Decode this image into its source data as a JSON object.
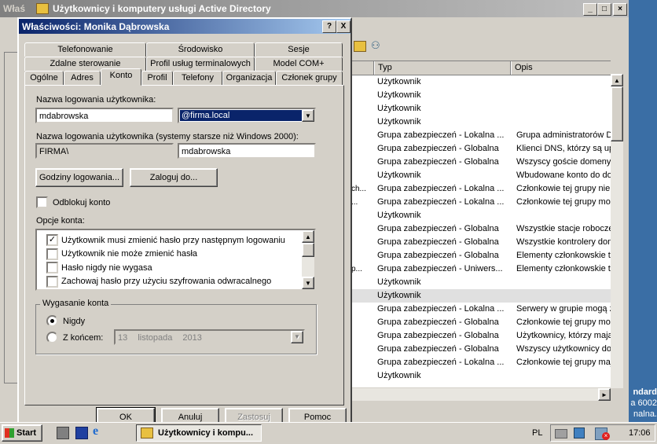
{
  "main_window": {
    "title_short": "Właś",
    "title": "Użytkownicy i komputery usługi Active Directory",
    "list": {
      "columns": [
        "Typ",
        "Opis"
      ],
      "rows": [
        {
          "typ": "Użytkownik",
          "opis": "",
          "prefix": ""
        },
        {
          "typ": "Użytkownik",
          "opis": "",
          "prefix": ""
        },
        {
          "typ": "Użytkownik",
          "opis": "",
          "prefix": ""
        },
        {
          "typ": "Użytkownik",
          "opis": "",
          "prefix": ""
        },
        {
          "typ": "Grupa zabezpieczeń - Lokalna ...",
          "opis": "Grupa administratorów DN",
          "prefix": ""
        },
        {
          "typ": "Grupa zabezpieczeń - Globalna",
          "opis": "Klienci DNS, którzy są upo",
          "prefix": ""
        },
        {
          "typ": "Grupa zabezpieczeń - Globalna",
          "opis": "Wszyscy goście domeny",
          "prefix": ""
        },
        {
          "typ": "Użytkownik",
          "opis": "Wbudowane konto do dos",
          "prefix": ""
        },
        {
          "typ": "Grupa zabezpieczeń - Lokalna ...",
          "opis": "Członkowie tej grupy nie .",
          "prefix": "ch..."
        },
        {
          "typ": "Grupa zabezpieczeń - Lokalna ...",
          "opis": "Członkowie tej grupy mog",
          "prefix": "..."
        },
        {
          "typ": "Użytkownik",
          "opis": "",
          "prefix": ""
        },
        {
          "typ": "Grupa zabezpieczeń - Globalna",
          "opis": "Wszystkie stacje robocze i",
          "prefix": ""
        },
        {
          "typ": "Grupa zabezpieczeń - Globalna",
          "opis": "Wszystkie kontrolery dom.",
          "prefix": ""
        },
        {
          "typ": "Grupa zabezpieczeń - Globalna",
          "opis": "Elementy członkowskie tej",
          "prefix": ""
        },
        {
          "typ": "Grupa zabezpieczeń - Uniwers...",
          "opis": "Elementy członkowskie tej",
          "prefix": "p..."
        },
        {
          "typ": "Użytkownik",
          "opis": "",
          "prefix": ""
        },
        {
          "typ": "Użytkownik",
          "opis": "",
          "prefix": ""
        },
        {
          "typ": "Grupa zabezpieczeń - Lokalna ...",
          "opis": "Serwery w grupie mogą z.",
          "prefix": ""
        },
        {
          "typ": "Grupa zabezpieczeń - Globalna",
          "opis": "Członkowie tej grupy mog",
          "prefix": ""
        },
        {
          "typ": "Grupa zabezpieczeń - Globalna",
          "opis": "Użytkownicy, którzy mają",
          "prefix": ""
        },
        {
          "typ": "Grupa zabezpieczeń - Globalna",
          "opis": "Wszyscy użytkownicy do...",
          "prefix": ""
        },
        {
          "typ": "Grupa zabezpieczeń - Lokalna ...",
          "opis": "Członkowie tej grupy maj.",
          "prefix": ""
        },
        {
          "typ": "Użytkownik",
          "opis": "",
          "prefix": ""
        }
      ],
      "selected_index": 16
    }
  },
  "dialog": {
    "title": "Właściwości: Monika Dąbrowska",
    "help_btn": "?",
    "close_btn": "X",
    "tabs_row1": [
      "Telefonowanie",
      "Środowisko",
      "Sesje"
    ],
    "tabs_row2": [
      "Zdalne sterowanie",
      "Profil usług terminalowych",
      "Model COM+"
    ],
    "tabs_row3": [
      "Ogólne",
      "Adres",
      "Konto",
      "Profil",
      "Telefony",
      "Organizacja",
      "Członek grupy"
    ],
    "active_tab": "Konto",
    "logon_label": "Nazwa logowania użytkownika:",
    "logon_value": "mdabrowska",
    "domain_value": "@firma.local",
    "legacy_label": "Nazwa logowania użytkownika (systemy starsze niż Windows 2000):",
    "legacy_domain": "FIRMA\\",
    "legacy_value": "mdabrowska",
    "logon_hours_btn": "Godziny logowania...",
    "logon_to_btn": "Zaloguj do...",
    "unlock_label": "Odblokuj konto",
    "options_label": "Opcje konta:",
    "options": [
      {
        "label": "Użytkownik musi zmienić hasło przy następnym logowaniu",
        "checked": true
      },
      {
        "label": "Użytkownik nie może zmienić hasła",
        "checked": false
      },
      {
        "label": "Hasło nigdy nie wygasa",
        "checked": false
      },
      {
        "label": "Zachowaj hasło przy użyciu szyfrowania odwracalnego",
        "checked": false
      }
    ],
    "expire_group": "Wygasanie konta",
    "never_label": "Nigdy",
    "end_label": "Z końcem:",
    "date_day": "13",
    "date_month": "listopada",
    "date_year": "2013",
    "ok_btn": "OK",
    "cancel_btn": "Anuluj",
    "apply_btn": "Zastosuj",
    "help_footer_btn": "Pomoc"
  },
  "desktop_text": {
    "line1": "ndard",
    "line2": "a 6002",
    "line3": "nalna."
  },
  "taskbar": {
    "start": "Start",
    "task_label": "Użytkownicy i kompu...",
    "lang": "PL",
    "clock": "17:06"
  },
  "colors": {
    "title_active": "#0a246a",
    "title_gradient_end": "#a6caf0",
    "face": "#d4d0c8",
    "desktop": "#3a6ea5"
  }
}
